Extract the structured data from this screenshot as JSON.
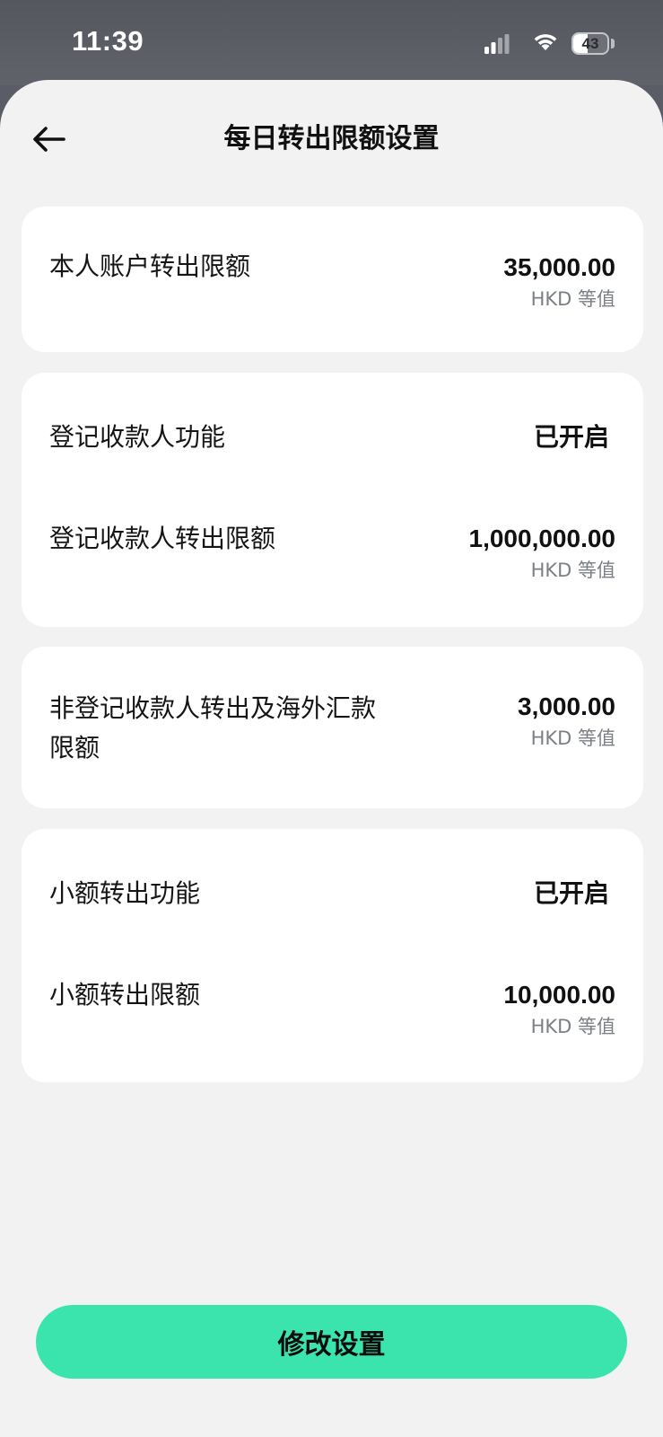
{
  "status_bar": {
    "time": "11:39",
    "battery_level": "43",
    "battery_fraction": 0.43,
    "icons": [
      "cellular-signal-icon",
      "wifi-icon",
      "battery-icon"
    ]
  },
  "header": {
    "title": "每日转出限额设置",
    "back_icon": "arrow-left-icon"
  },
  "sections": {
    "own_account": {
      "label": "本人账户转出限额",
      "amount": "35,000.00",
      "unit": "HKD 等值"
    },
    "registered_payee": {
      "feature_label": "登记收款人功能",
      "feature_status": "已开启",
      "limit_label": "登记收款人转出限额",
      "amount": "1,000,000.00",
      "unit": "HKD 等值"
    },
    "unregistered_payee": {
      "label_line1": "非登记收款人转出及海外汇款",
      "label_line2": "限额",
      "amount": "3,000.00",
      "unit": "HKD 等值"
    },
    "small_amount": {
      "feature_label": "小额转出功能",
      "feature_status": "已开启",
      "limit_label": "小额转出限额",
      "amount": "10,000.00",
      "unit": "HKD 等值"
    }
  },
  "footer": {
    "button_label": "修改设置"
  },
  "colors": {
    "accent": "#3be4ad",
    "background": "#f2f2f3",
    "card": "#ffffff",
    "secondary_text": "#7b7f87",
    "status_bar": "#5b5d66"
  }
}
